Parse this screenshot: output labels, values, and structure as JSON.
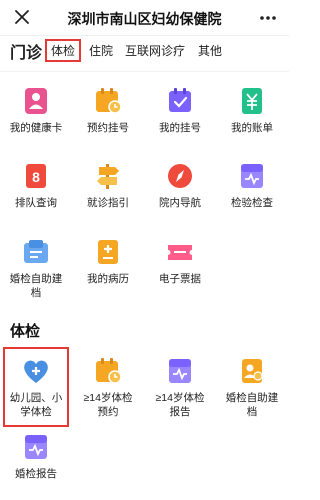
{
  "header": {
    "title": "深圳市南山区妇幼保健院"
  },
  "tabs": [
    {
      "label": "门诊"
    },
    {
      "label": "体检"
    },
    {
      "label": "住院"
    },
    {
      "label": "互联网诊疗"
    },
    {
      "label": "其他"
    }
  ],
  "outpatient": {
    "items": [
      {
        "label": "我的健康卡",
        "icon": "health-card-icon",
        "color": "#e9538f"
      },
      {
        "label": "预约挂号",
        "icon": "appointment-icon",
        "color": "#f5a623"
      },
      {
        "label": "我的挂号",
        "icon": "my-registration-icon",
        "color": "#7b61ff"
      },
      {
        "label": "我的账单",
        "icon": "bill-icon",
        "color": "#22c08a"
      },
      {
        "label": "排队查询",
        "icon": "queue-icon",
        "color": "#ef4a3c"
      },
      {
        "label": "就诊指引",
        "icon": "guide-signpost-icon",
        "color": "#f5a623"
      },
      {
        "label": "院内导航",
        "icon": "compass-icon",
        "color": "#ef4a3c"
      },
      {
        "label": "检验检查",
        "icon": "lab-report-icon",
        "color": "#7b61ff"
      },
      {
        "label": "婚检自助建档",
        "icon": "premarital-archive-icon",
        "color": "#4a90e2"
      },
      {
        "label": "我的病历",
        "icon": "medical-record-icon",
        "color": "#f5a623"
      },
      {
        "label": "电子票据",
        "icon": "e-receipt-icon",
        "color": "#ff5c8a"
      }
    ]
  },
  "checkup": {
    "title": "体检",
    "items": [
      {
        "label": "幼儿园、小学体检",
        "icon": "heart-plus-icon",
        "color": "#4a90e2"
      },
      {
        "label": "≥14岁体检预约",
        "icon": "calendar-clock-icon",
        "color": "#f5a623"
      },
      {
        "label": "≥14岁体检报告",
        "icon": "report-pulse-icon",
        "color": "#7b61ff"
      },
      {
        "label": "婚检自助建档",
        "icon": "premarital-checkup-icon",
        "color": "#f5a623"
      },
      {
        "label": "婚检报告",
        "icon": "premarital-report-icon",
        "color": "#7b61ff"
      }
    ]
  }
}
